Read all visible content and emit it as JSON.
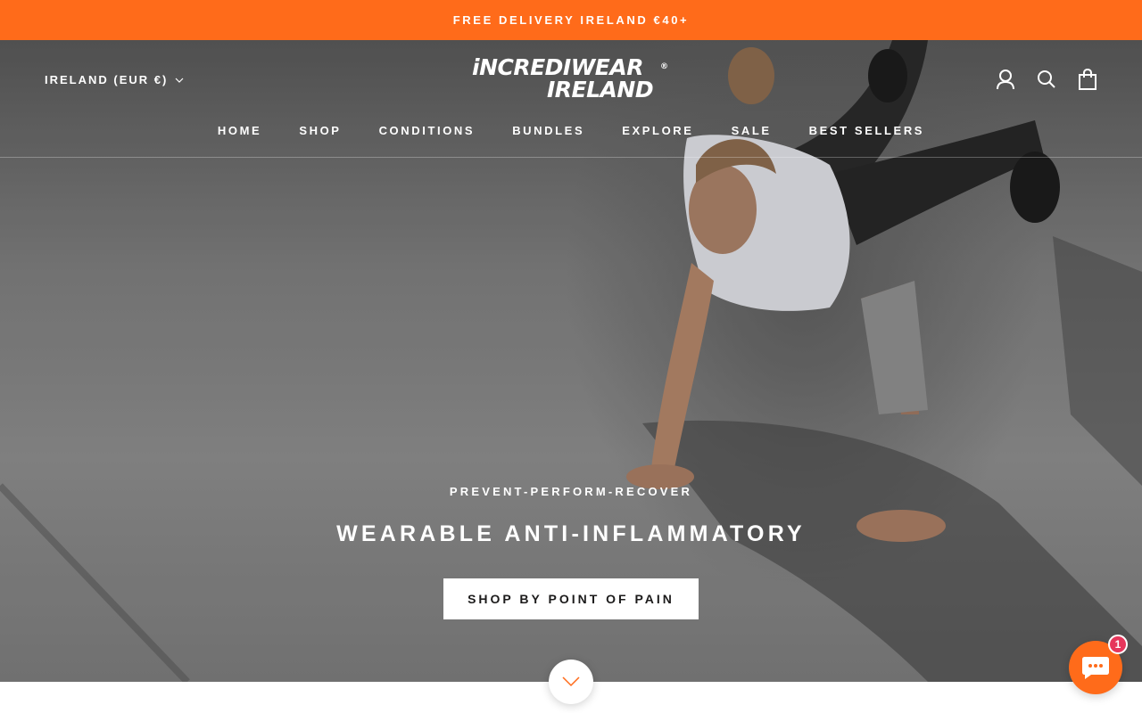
{
  "announcement": {
    "text": "FREE DELIVERY IRELAND €40+",
    "background": "#ff6b1a"
  },
  "header": {
    "country_selector": "IRELAND (EUR €)",
    "logo": {
      "line1": "iNCREDIWEAR",
      "line2": "IRELAND",
      "registered": "®"
    },
    "icons": [
      "account-icon",
      "search-icon",
      "cart-icon"
    ]
  },
  "nav": {
    "items": [
      {
        "label": "HOME"
      },
      {
        "label": "SHOP"
      },
      {
        "label": "CONDITIONS"
      },
      {
        "label": "BUNDLES"
      },
      {
        "label": "EXPLORE"
      },
      {
        "label": "SALE"
      },
      {
        "label": "BEST SELLERS"
      }
    ]
  },
  "hero": {
    "subheading": "PREVENT-PERFORM-RECOVER",
    "headline": "WEARABLE ANTI-INFLAMMATORY",
    "cta_label": "SHOP BY POINT OF PAIN"
  },
  "scroll_down": {
    "icon": "chevron-down-icon",
    "color": "#ff6b1a"
  },
  "chat": {
    "icon": "chat-bubble-icon",
    "badge_count": "1",
    "color": "#ff6b1a",
    "badge_color": "#e6365b"
  }
}
